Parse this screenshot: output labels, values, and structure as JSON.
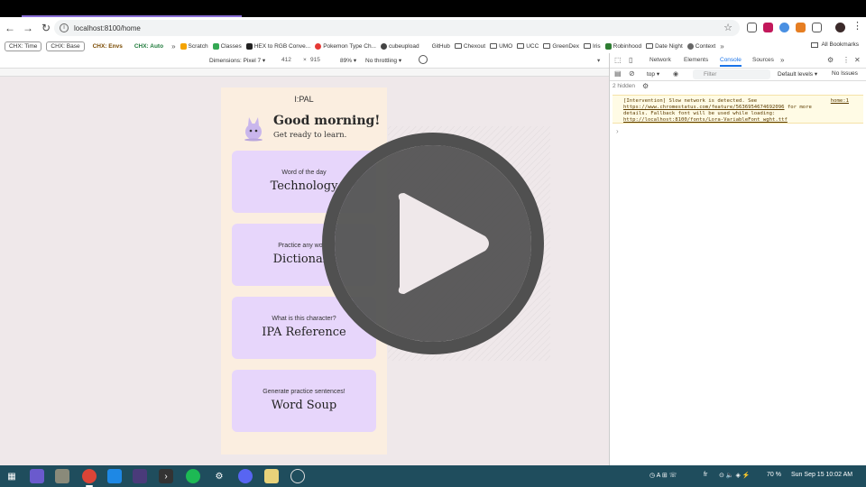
{
  "browser": {
    "url": "localhost:8100/home",
    "bookmarks": [
      {
        "label": "CHX: Time",
        "type": "chip"
      },
      {
        "label": "CHX: Base",
        "type": "chip"
      },
      {
        "label": "CHX: Envs",
        "type": "chip-filled",
        "color": "#7a4a00"
      },
      {
        "label": "CHX: Auto",
        "type": "chip-filled",
        "color": "#1e7a3a"
      }
    ],
    "bookmark_links": [
      "Scratch",
      "Classes",
      "HEX to RGB Conve...",
      "Pokemon Type Ch...",
      "cubeupload",
      "GitHub",
      "Chexout",
      "UMO",
      "UCC",
      "GreenDex",
      "Iris",
      "Robinhood",
      "Date Night",
      "Context"
    ],
    "all_bookmarks": "All Bookmarks"
  },
  "device_toolbar": {
    "dimensions": "Dimensions: Pixel 7 ▾",
    "width": "412",
    "x": "×",
    "height": "915",
    "zoom": "89% ▾",
    "throttling": "No throttling ▾",
    "more": "▾"
  },
  "app": {
    "title": "I:PAL",
    "greeting": "Good morning!",
    "subtitle": "Get ready to learn.",
    "cards": [
      {
        "caption": "Word of the day",
        "title": "Technology"
      },
      {
        "caption": "Practice any word!",
        "title": "Dictionary"
      },
      {
        "caption": "What is this character?",
        "title": "IPA Reference"
      },
      {
        "caption": "Generate practice sentences!",
        "title": "Word Soup"
      }
    ]
  },
  "devtools": {
    "tabs": [
      "Network",
      "Elements",
      "Console",
      "Sources"
    ],
    "active_tab": "Console",
    "context": "top ▾",
    "filter_placeholder": "Filter",
    "levels": "Default levels ▾",
    "issues": "No Issues",
    "hidden": "2 hidden",
    "warning": {
      "text1": "[Intervention] Slow network is detected. See",
      "link1": "https://www.chromestatus.com/feature/5636954674692096",
      "text2": "for more",
      "text3": "details. Fallback font will be used while loading:",
      "link2": "http://localhost:8100/fonts/Lora-VariableFont_wght.ttf",
      "source": "home:1"
    },
    "prompt": "›"
  },
  "taskbar": {
    "lang": "fr",
    "battery": "70 %",
    "datetime": "Sun Sep 15  10:02 AM"
  }
}
